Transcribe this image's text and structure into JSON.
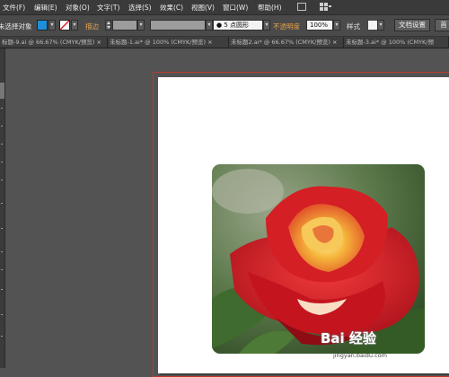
{
  "menubar": {
    "items": [
      "文件(F)",
      "编辑(E)",
      "对象(O)",
      "文字(T)",
      "选择(S)",
      "效果(C)",
      "视图(V)",
      "窗口(W)",
      "帮助(H)"
    ]
  },
  "controlbar": {
    "selection_label": "未选择对象",
    "stroke_label": "描边",
    "brush_value": "5 点圆形",
    "opacity_label": "不透明度",
    "opacity_value": "100%",
    "style_label": "样式",
    "doc_setup_label": "文档设置",
    "prefs_label": "首",
    "fill_color": "#1e8fd8"
  },
  "tabs": [
    "标题-9.ai @ 66.67% (CMYK/预览)",
    "未标题-1.ai* @ 100% (CMYK/预览)",
    "未标题2.ai* @ 66.67% (CMYK/预览)",
    "未标题-3.ai* @ 100% (CMYK/预"
  ],
  "watermark": {
    "main": "Bai 经验",
    "sub": "jingyan.baidu.com"
  }
}
